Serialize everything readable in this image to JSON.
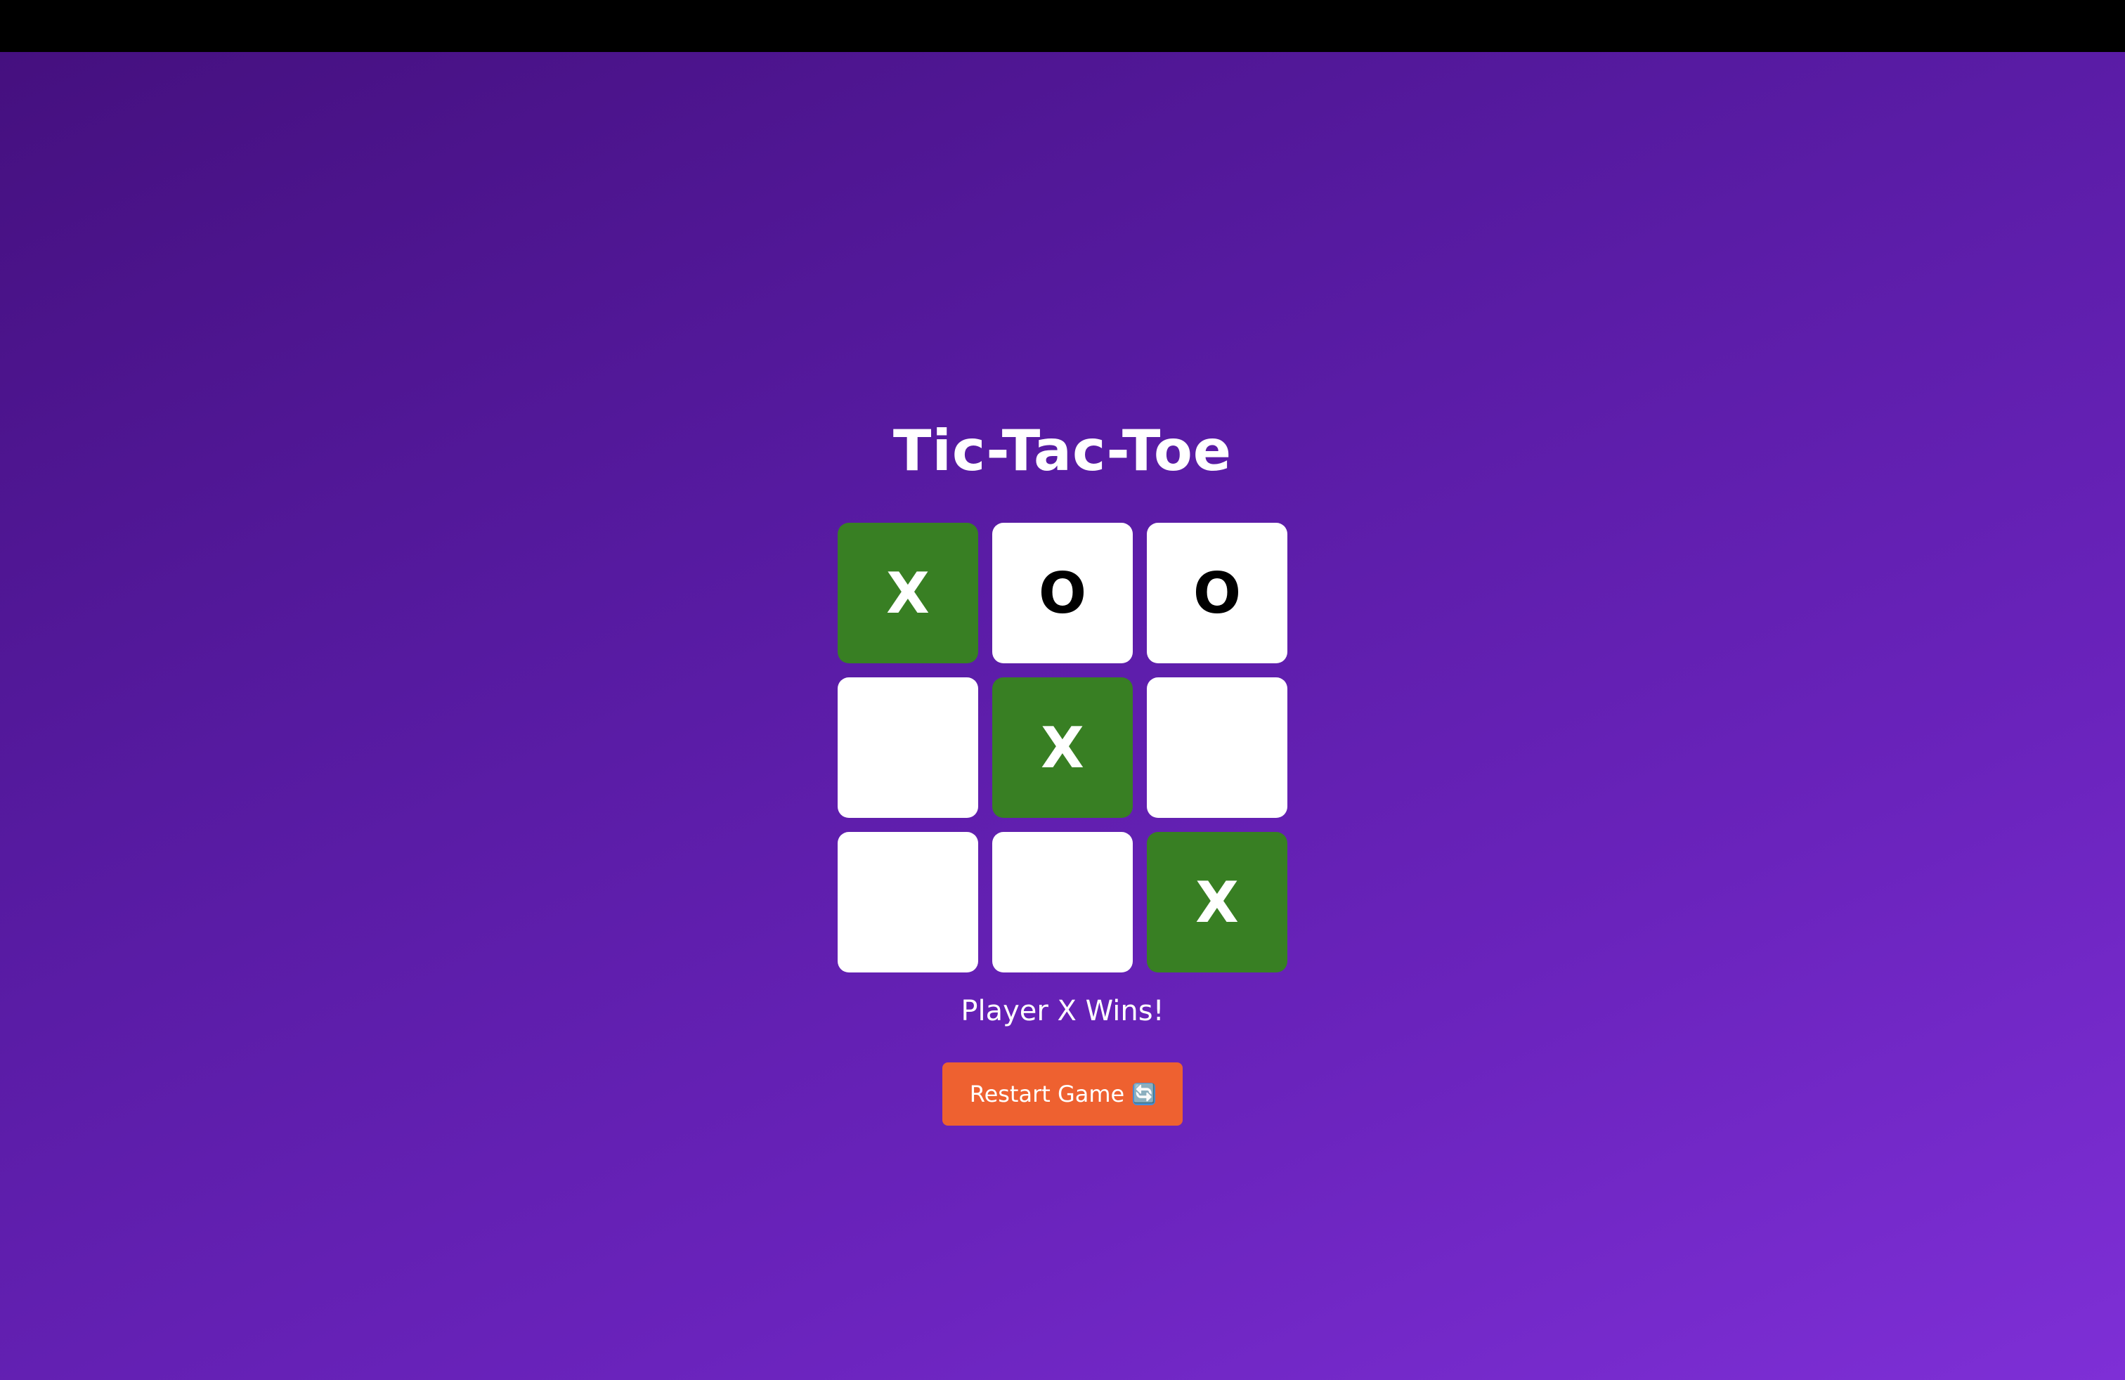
{
  "game": {
    "title": "Tic-Tac-Toe",
    "board": [
      {
        "mark": "X",
        "winning": true
      },
      {
        "mark": "O",
        "winning": false
      },
      {
        "mark": "O",
        "winning": false
      },
      {
        "mark": "",
        "winning": false
      },
      {
        "mark": "X",
        "winning": true
      },
      {
        "mark": "",
        "winning": false
      },
      {
        "mark": "",
        "winning": false
      },
      {
        "mark": "",
        "winning": false
      },
      {
        "mark": "X",
        "winning": true
      }
    ],
    "status": "Player X Wins!",
    "restart_label": "Restart Game",
    "restart_icon": "refresh-icon",
    "restart_icon_glyph": "🔄"
  },
  "colors": {
    "win_cell": "#387f23",
    "cell": "#ffffff",
    "restart_button": "#ee6130",
    "background_start": "#45107f",
    "background_end": "#7e2fd6"
  }
}
